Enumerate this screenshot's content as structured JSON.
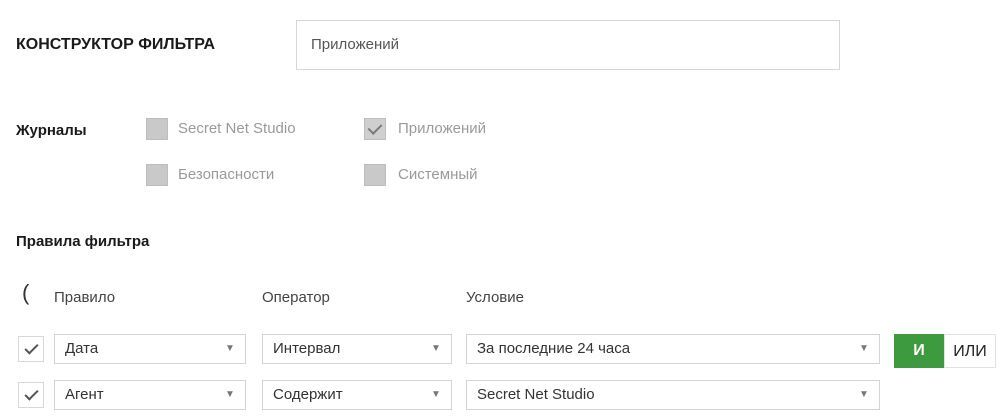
{
  "builder": {
    "title": "КОНСТРУКТОР ФИЛЬТРА",
    "input_value": "Приложений"
  },
  "journals": {
    "label": "Журналы",
    "options": [
      {
        "label": "Secret Net Studio",
        "checked": false
      },
      {
        "label": "Приложений",
        "checked": true
      },
      {
        "label": "Безопасности",
        "checked": false
      },
      {
        "label": "Системный",
        "checked": false
      }
    ]
  },
  "rules": {
    "title": "Правила фильтра",
    "group_bracket": "(",
    "columns": {
      "rule": "Правило",
      "operator": "Оператор",
      "condition": "Условие"
    },
    "rows": [
      {
        "checked": true,
        "rule": "Дата",
        "operator": "Интервал",
        "condition": "За последние 24 часа"
      },
      {
        "checked": true,
        "rule": "Агент",
        "operator": "Содержит",
        "condition": "Secret Net Studio"
      }
    ],
    "logic": {
      "and_label": "И",
      "or_label": "ИЛИ",
      "selected": "И"
    }
  },
  "icons": {
    "dropdown": "chevron-down-icon",
    "check": "check-icon"
  },
  "colors": {
    "accent": "#3d9a3f"
  }
}
